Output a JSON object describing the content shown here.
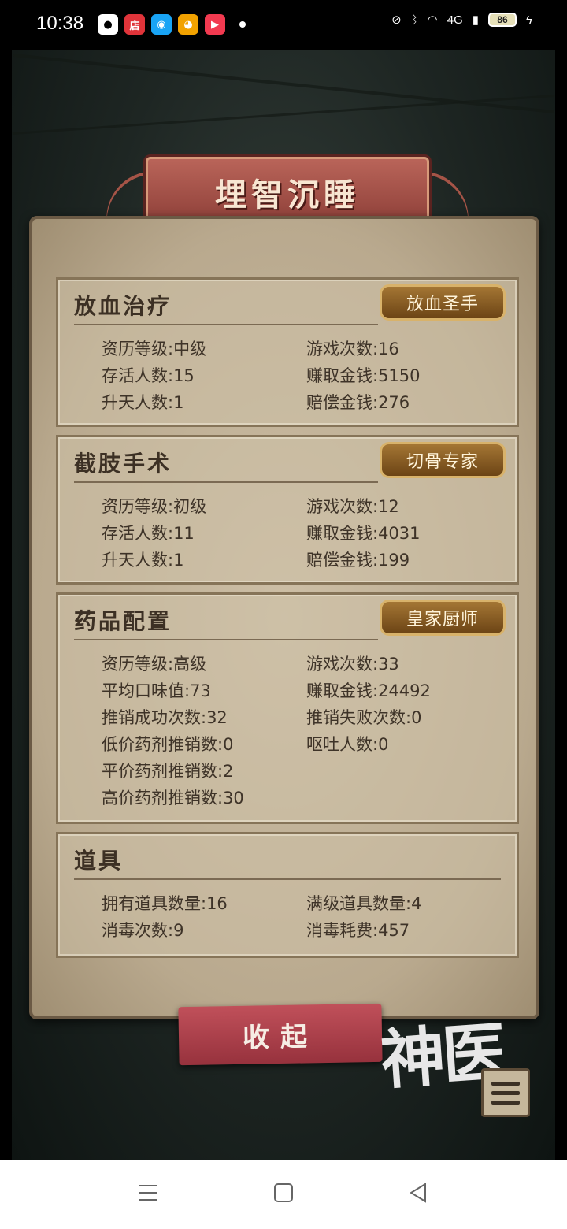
{
  "status_bar": {
    "time": "10:38",
    "battery": "86",
    "network": "4G",
    "apps": [
      {
        "name": "wechat-icon",
        "glyph": "●",
        "color": "#000"
      },
      {
        "name": "store-icon",
        "glyph": "店",
        "color": "#e0343a"
      },
      {
        "name": "qq-icon",
        "glyph": "◉",
        "color": "#19a4f5"
      },
      {
        "name": "weibo-icon",
        "glyph": "◕",
        "color": "#f2a200"
      },
      {
        "name": "video-icon",
        "glyph": "▶",
        "color": "#f23a50"
      }
    ]
  },
  "game": {
    "banner_title": "埋智沉睡",
    "sections": [
      {
        "title": "放血治疗",
        "badge": "放血圣手",
        "rows": [
          [
            "资历等级:中级",
            "游戏次数:16"
          ],
          [
            "存活人数:15",
            "赚取金钱:5150"
          ],
          [
            "升天人数:1",
            "赔偿金钱:276"
          ]
        ]
      },
      {
        "title": "截肢手术",
        "badge": "切骨专家",
        "rows": [
          [
            "资历等级:初级",
            "游戏次数:12"
          ],
          [
            "存活人数:11",
            "赚取金钱:4031"
          ],
          [
            "升天人数:1",
            "赔偿金钱:199"
          ]
        ]
      },
      {
        "title": "药品配置",
        "badge": "皇家厨师",
        "rows": [
          [
            "资历等级:高级",
            "游戏次数:33"
          ],
          [
            "平均口味值:73",
            "赚取金钱:24492"
          ],
          [
            "推销成功次数:32",
            "推销失败次数:0"
          ],
          [
            "低价药剂推销数:0",
            "呕吐人数:0"
          ],
          [
            "平价药剂推销数:2",
            ""
          ],
          [
            "高价药剂推销数:30",
            ""
          ]
        ]
      },
      {
        "title": "道具",
        "badge": "",
        "rows": [
          [
            "拥有道具数量:16",
            "满级道具数量:4"
          ],
          [
            "消毒次数:9",
            "消毒耗费:457"
          ]
        ]
      }
    ],
    "collapse_label": "收起",
    "logo_text": "神医"
  },
  "colors": {
    "banner": "#a24f47",
    "paper": "#c4b59a",
    "badge": "#8d5d27",
    "button": "#b0424d"
  }
}
